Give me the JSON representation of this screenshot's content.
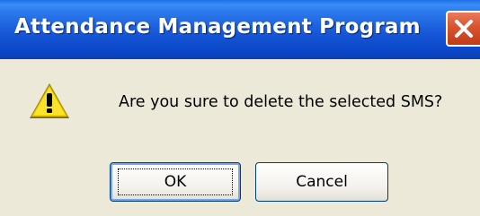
{
  "window": {
    "title": "Attendance Management Program"
  },
  "dialog": {
    "icon": "warning-icon",
    "message": "Are you sure to delete the selected SMS?"
  },
  "buttons": {
    "ok_label": "OK",
    "cancel_label": "Cancel"
  },
  "colors": {
    "titlebar": "#0a47c9",
    "close_button": "#d9532f",
    "dialog_background": "#ece9d8",
    "warning_yellow": "#f5d800"
  }
}
